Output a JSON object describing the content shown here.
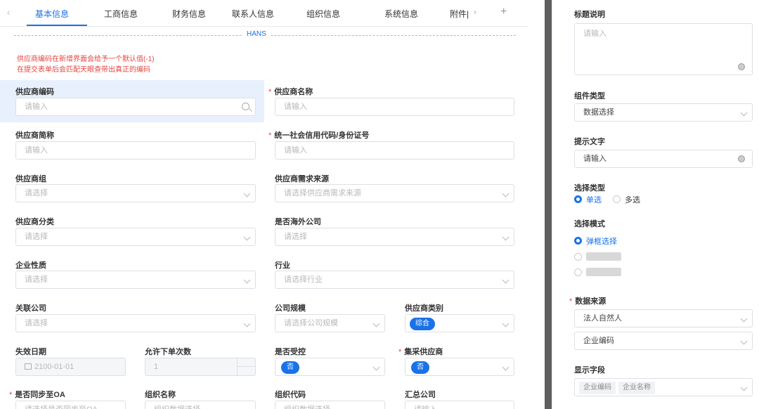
{
  "tabs": [
    "基本信息",
    "工商信息",
    "财务信息",
    "联系人信息",
    "组织信息",
    "系统信息",
    "附件|"
  ],
  "section_label": "HANS",
  "notes": [
    "供应商编码在新增界面会给予一个默认值(-1)",
    "在提交表单后会匹配天眼查带出真正的编码"
  ],
  "form": {
    "supplier_code": {
      "label": "供应商编码",
      "placeholder": "请输入"
    },
    "supplier_name": {
      "label": "供应商名称",
      "placeholder": "请输入"
    },
    "supplier_short": {
      "label": "供应商简称",
      "placeholder": "请输入"
    },
    "credit_code": {
      "label": "统一社会信用代码/身份证号",
      "placeholder": "请输入"
    },
    "supplier_group": {
      "label": "供应商组",
      "placeholder": "请选择"
    },
    "demand_source": {
      "label": "供应商需求来源",
      "placeholder": "请选择供应商需求来源"
    },
    "supplier_category": {
      "label": "供应商分类",
      "placeholder": "请选择"
    },
    "overseas": {
      "label": "是否海外公司",
      "placeholder": "请选择"
    },
    "enterprise_nature": {
      "label": "企业性质",
      "placeholder": "请选择"
    },
    "industry": {
      "label": "行业",
      "placeholder": "请选择行业"
    },
    "related_company": {
      "label": "关联公司",
      "placeholder": "请选择"
    },
    "company_scale": {
      "label": "公司规模",
      "placeholder": "请选择公司规模"
    },
    "supplier_type": {
      "label": "供应商类别",
      "value": "综合"
    },
    "expire_date": {
      "label": "失效日期",
      "value": "2100-01-01"
    },
    "allow_orders": {
      "label": "允许下单次数",
      "value": "1"
    },
    "controlled": {
      "label": "是否受控",
      "value": "否"
    },
    "central_supplier": {
      "label": "集采供应商",
      "value": "否"
    },
    "sync_oa": {
      "label": "是否同步至OA",
      "placeholder": "请选择是否同步至OA"
    },
    "org_name": {
      "label": "组织名称",
      "placeholder": "组织数据选择"
    },
    "org_code": {
      "label": "组织代码",
      "placeholder": "组织数据选择"
    },
    "summary_company": {
      "label": "汇总公司",
      "placeholder": "请输入"
    }
  },
  "panel": {
    "title_desc": {
      "label": "标题说明",
      "placeholder": "请输入"
    },
    "component_type": {
      "label": "组件类型",
      "value": "数据选择"
    },
    "hint_text": {
      "label": "提示文字",
      "value": "请输入"
    },
    "select_type": {
      "label": "选择类型",
      "options": [
        "单选",
        "多选"
      ]
    },
    "select_mode": {
      "label": "选择模式",
      "options": [
        "弹框选择"
      ]
    },
    "data_source": {
      "label": "数据来源",
      "value": "法人自然人",
      "second": "企业编码"
    },
    "display_fields": {
      "label": "显示字段",
      "chips": [
        "企业编码",
        "企业名称"
      ]
    }
  }
}
